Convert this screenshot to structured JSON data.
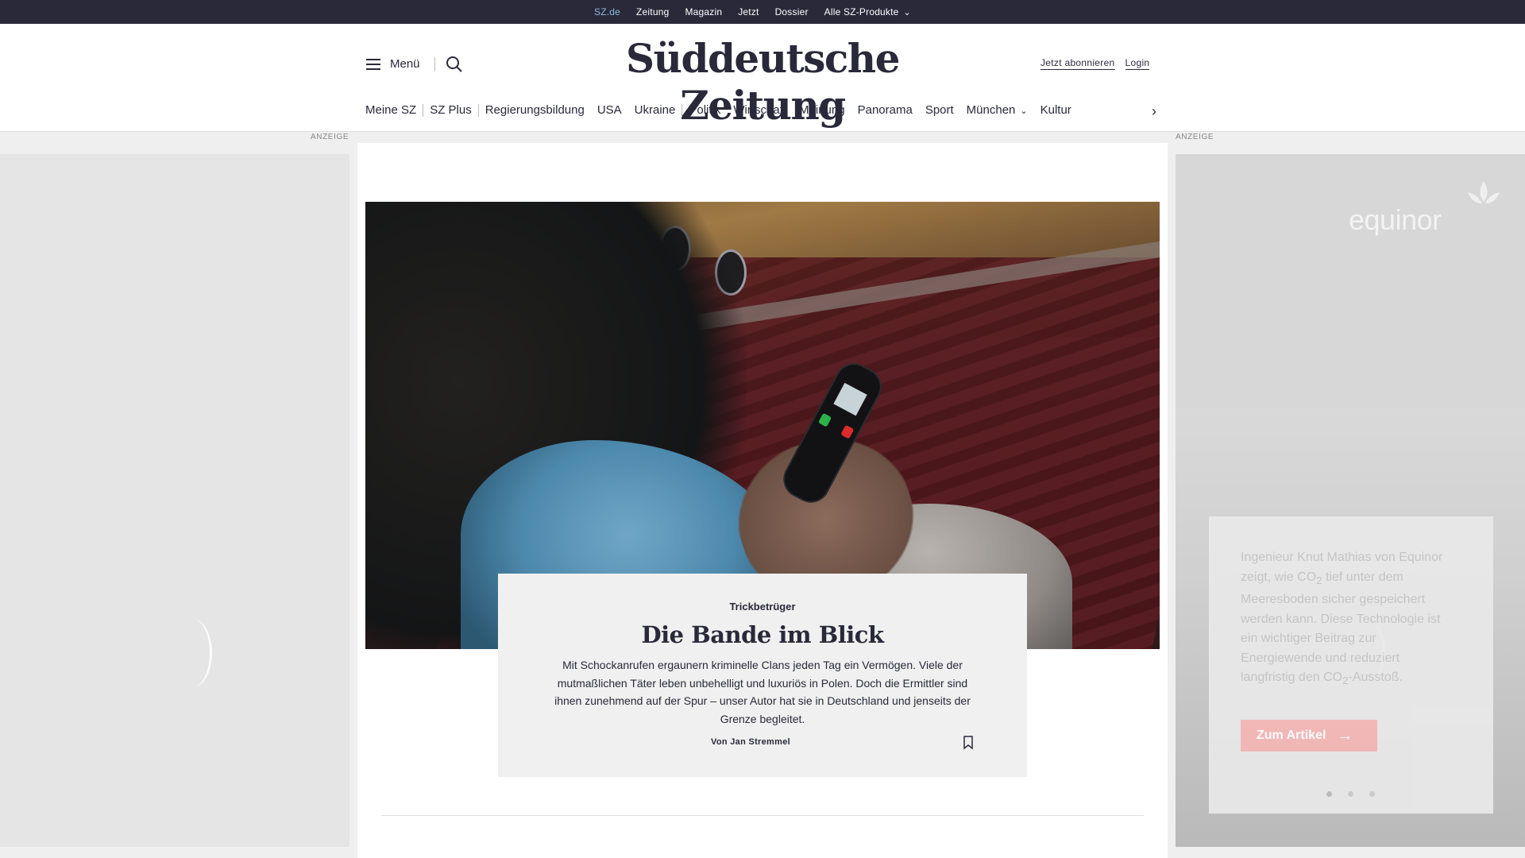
{
  "topbar": {
    "items": [
      "SZ.de",
      "Zeitung",
      "Magazin",
      "Jetzt",
      "Dossier",
      "Alle SZ-Produkte"
    ]
  },
  "header": {
    "menu_label": "Menü",
    "logo": "Süddeutsche Zeitung",
    "subscribe_label": "Jetzt abonnieren",
    "login_label": "Login"
  },
  "nav": {
    "items": [
      "Meine SZ",
      "SZ Plus",
      "Regierungsbildung",
      "USA",
      "Ukraine",
      "Politik",
      "Wirtschaft",
      "Meinung",
      "Panorama",
      "Sport",
      "München",
      "Kultur"
    ]
  },
  "ads": {
    "label_left": "ANZEIGE",
    "label_right": "ANZEIGE",
    "right": {
      "brand": "equinor",
      "text_1": "Ingenieur Knut Mathias von Equinor zeigt, wie CO",
      "text_sub": "2",
      "text_2": " tief unter dem Meeresboden sicher gespeichert werden kann. Diese Technologie ist ein wichtiger Beitrag zur Energiewende und reduziert langfristig den CO",
      "text_sub_2": "2",
      "text_3": "-Ausstoß.",
      "cta_label": "Zum Artikel",
      "accent": "#f5b7b7"
    }
  },
  "teaser": {
    "kicker": "Trickbetrüger",
    "title": "Die Bande im Blick",
    "lead": "Mit Schockanrufen ergaunern kriminelle Clans jeden Tag ein Vermögen. Viele der mutmaßlichen Täter leben unbehelligt und luxuriös in Polen.  Doch die Ermittler sind ihnen zunehmend auf der Spur – unser Autor hat sie in Deutschland und jenseits der Grenze begleitet.",
    "author": "Von Jan Stremmel"
  },
  "colors": {
    "brand_dark": "#29293a",
    "active_link": "#8fb7df"
  }
}
